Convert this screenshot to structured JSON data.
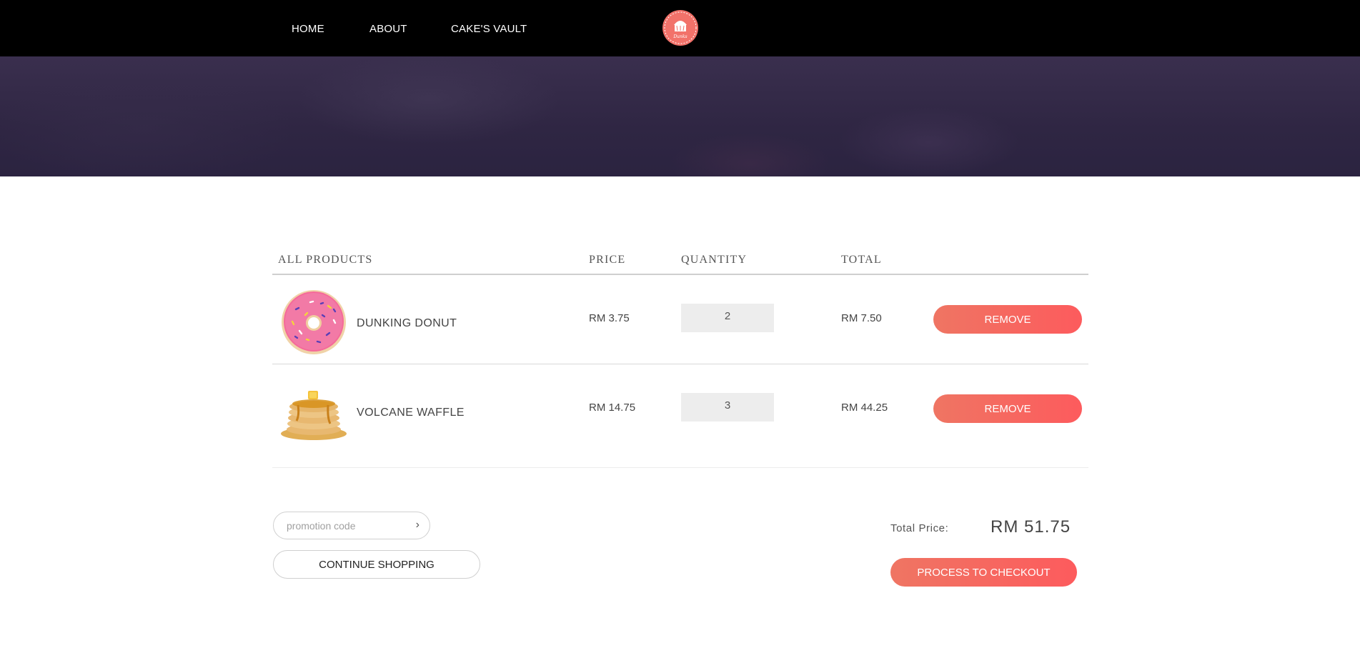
{
  "nav": {
    "links": [
      "HOME",
      "ABOUT",
      "CAKE'S VAULT"
    ],
    "logo_text": "Dunks",
    "logo_color": "#f2726a"
  },
  "cart": {
    "headers": {
      "products": "ALL PRODUCTS",
      "price": "PRICE",
      "quantity": "QUANTITY",
      "total": "TOTAL"
    },
    "items": [
      {
        "name": "DUNKING DONUT",
        "price": "RM 3.75",
        "quantity": "2",
        "total": "RM 7.50",
        "remove_label": "REMOVE",
        "image_icon": "donut-image"
      },
      {
        "name": "VOLCANE WAFFLE",
        "price": "RM 14.75",
        "quantity": "3",
        "total": "RM 44.25",
        "remove_label": "REMOVE",
        "image_icon": "pancake-image"
      }
    ]
  },
  "footer": {
    "promo_placeholder": "promotion code",
    "promo_submit_glyph": "›",
    "continue_label": "CONTINUE SHOPPING",
    "total_label": "Total Price:",
    "total_value": "RM 51.75",
    "checkout_label": "PROCESS TO CHECKOUT"
  },
  "colors": {
    "accent": "#fd5b5d",
    "accent_start": "#ef7563",
    "hero": "#2f2643"
  }
}
